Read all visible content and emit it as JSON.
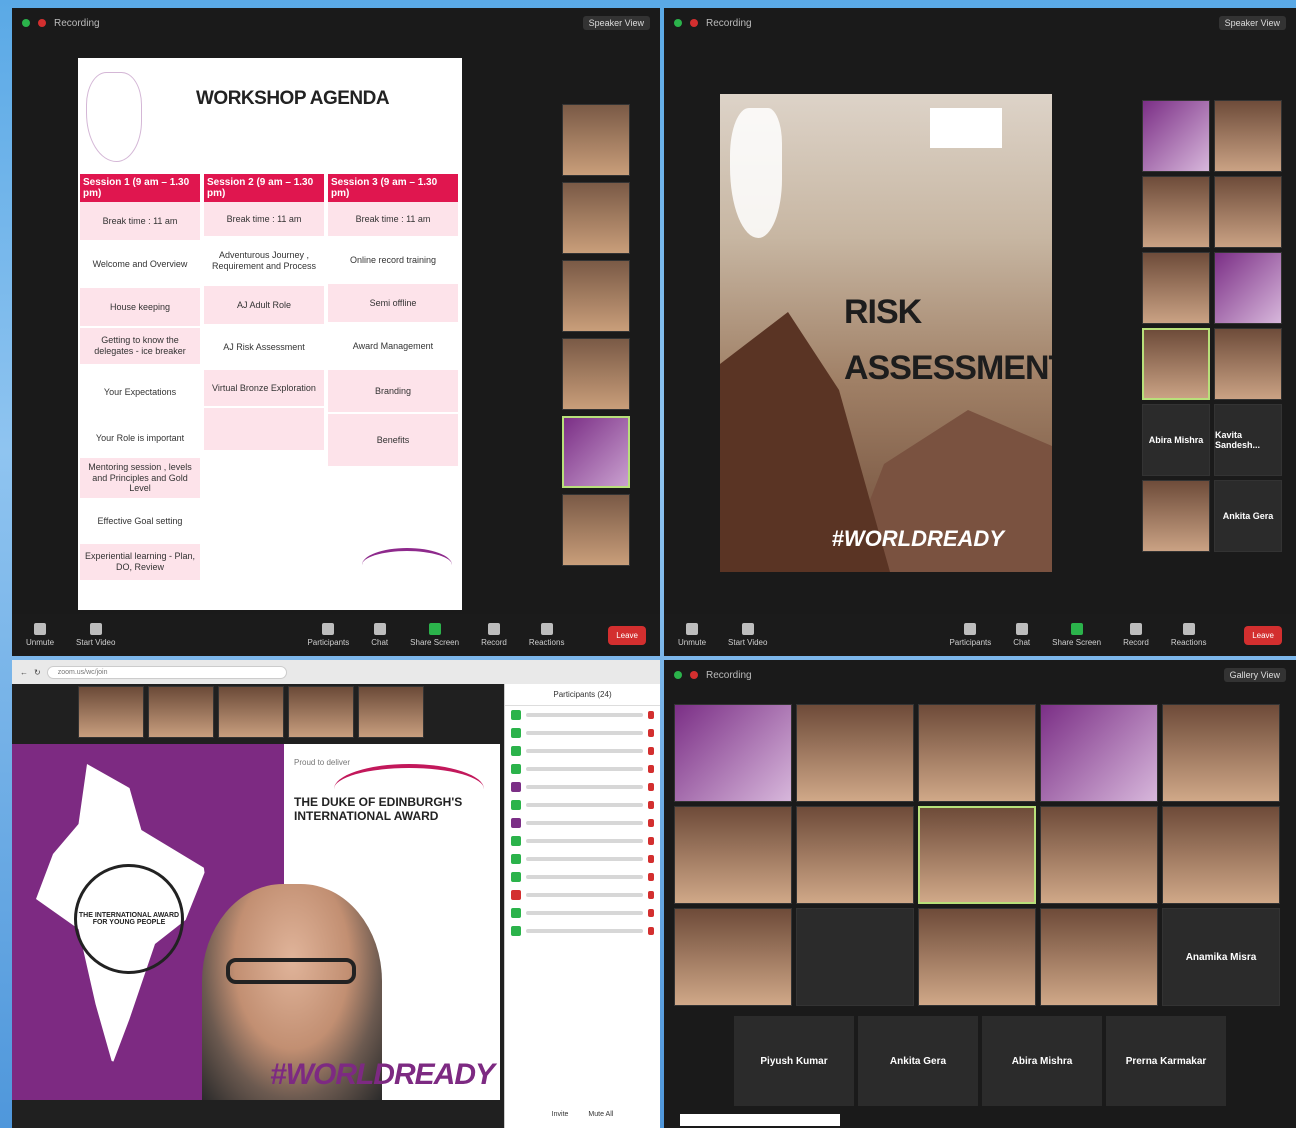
{
  "q1": {
    "status": "Recording",
    "view": "Speaker View",
    "slide_title": "WORKSHOP AGENDA",
    "sessions": [
      {
        "header": "Session 1 (9 am – 1.30 pm)",
        "items": [
          "Break time : 11 am",
          "Welcome and Overview",
          "House keeping",
          "Getting to know the delegates - ice breaker",
          "Your Expectations",
          "Your Role is important",
          "Mentoring session , levels and Principles and Gold Level",
          "Effective Goal setting",
          "Experiential learning - Plan, DO, Review"
        ]
      },
      {
        "header": "Session 2 (9 am – 1.30 pm)",
        "items": [
          "Break time : 11 am",
          "Adventurous Journey , Requirement and Process",
          "AJ Adult Role",
          "AJ Risk Assessment",
          "Virtual Bronze Exploration"
        ]
      },
      {
        "header": "Session 3 (9 am – 1.30 pm)",
        "items": [
          "Break time : 11 am",
          "Online record training",
          "Semi offline",
          "Award Management",
          "Branding",
          "Benefits"
        ]
      }
    ],
    "toolbar": [
      "Unmute",
      "Start Video",
      "Participants",
      "Chat",
      "Share Screen",
      "Record",
      "Reactions"
    ],
    "end_label": "Leave"
  },
  "q2": {
    "status": "Recording",
    "view": "Speaker View",
    "slide_title_line1": "RISK",
    "slide_title_line2": "ASSESSMENT",
    "hashtag": "#WORLDREADY",
    "name_tiles": [
      "Abira Mishra",
      "Kavita Sandesh...",
      "Ankita Gera"
    ],
    "toolbar": [
      "Unmute",
      "Start Video",
      "Participants",
      "Chat",
      "Share Screen",
      "Record",
      "Reactions"
    ],
    "end_label": "Leave"
  },
  "q3": {
    "url": "zoom.us/wc/join",
    "proud": "Proud to deliver",
    "duke_line1": "THE DUKE OF EDINBURGH'S",
    "duke_line2": "INTERNATIONAL AWARD",
    "seal_text": "THE INTERNATIONAL AWARD FOR YOUNG PEOPLE",
    "hashtag": "#WORLDREADY",
    "panel_title": "Participants (24)",
    "panel_buttons": [
      "Invite",
      "Mute All"
    ]
  },
  "q4": {
    "status": "Recording",
    "view": "Gallery View",
    "name_tiles": [
      "Anamika Misra"
    ],
    "bottom_names": [
      "Piyush Kumar",
      "Ankita Gera",
      "Abira Mishra",
      "Prerna Karmakar"
    ]
  },
  "colors": {
    "accent_red": "#e0164f",
    "purple": "#7d2a82",
    "zoom_green": "#2bb34b"
  }
}
